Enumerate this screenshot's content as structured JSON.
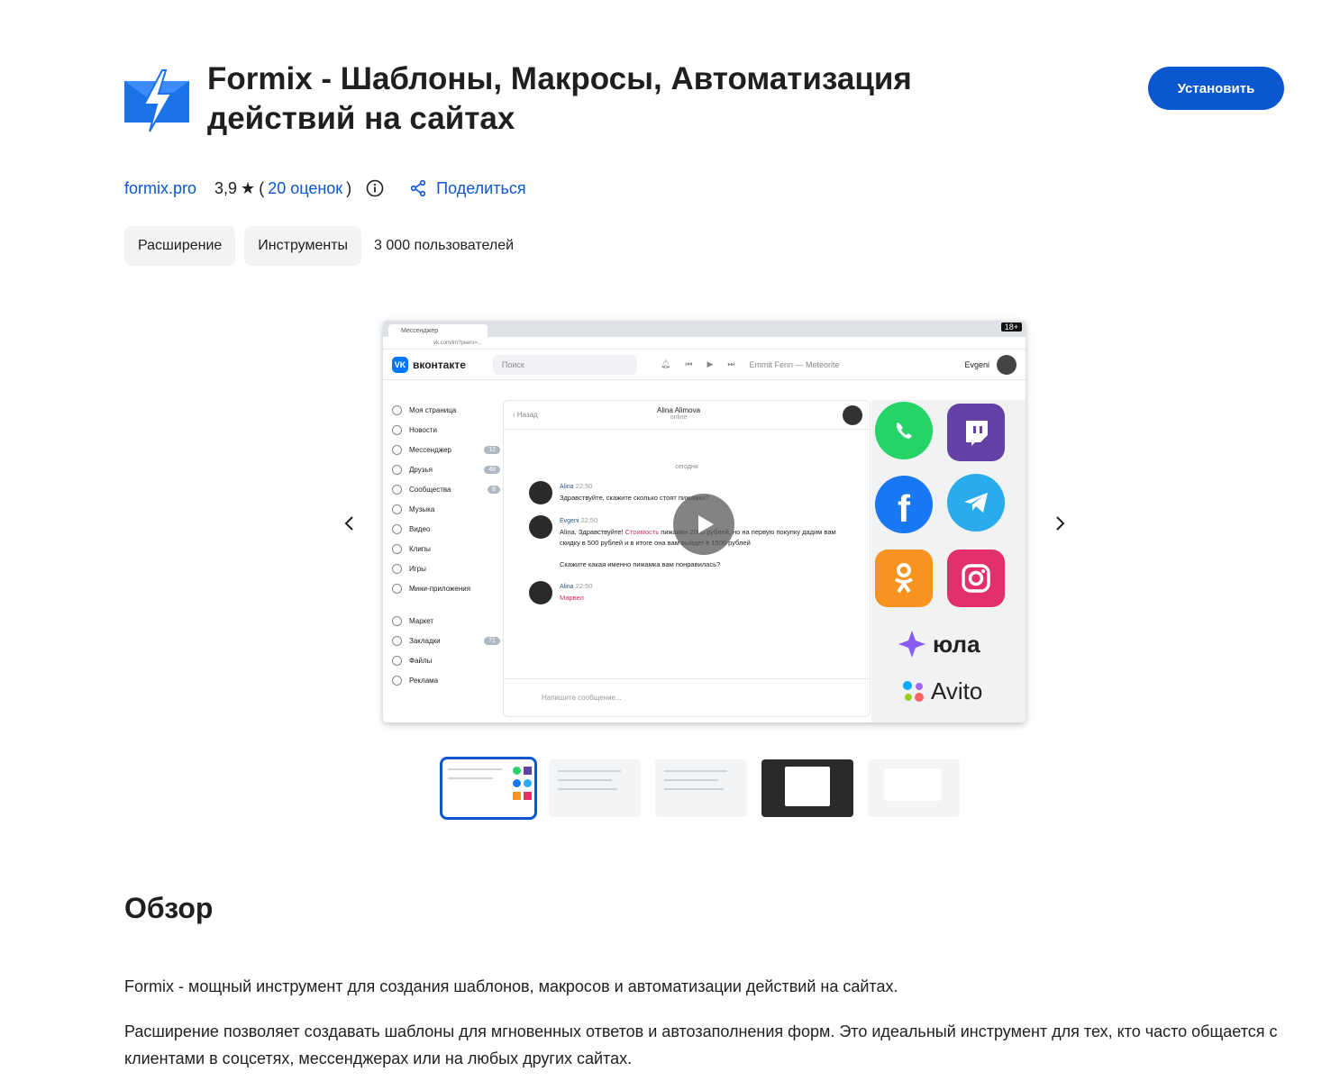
{
  "header": {
    "title_line1": "Formix - Шаблоны, Макросы, Автоматизация",
    "title_line2": "действий на сайтах",
    "install_label": "Установить",
    "logo_icon": "lightning-envelope-icon"
  },
  "meta": {
    "site": "formix.pro",
    "rating": "3,9",
    "reviews_open": "(",
    "reviews": "20 оценок",
    "reviews_close": ")",
    "share_label": "Поделиться"
  },
  "chips": {
    "type": "Расширение",
    "category": "Инструменты",
    "users": "3 000 пользователей"
  },
  "screenshot": {
    "tab_title": "Мессенджер",
    "age_badge": "18+",
    "address": "vk.com/im?peers=...",
    "brand": "вконтакте",
    "search_placeholder": "Поиск",
    "player_track": "Emmit Fenn — Meteorite",
    "user_name": "Evgeni",
    "sidebar": [
      {
        "label": "Моя страница",
        "count": ""
      },
      {
        "label": "Новости",
        "count": ""
      },
      {
        "label": "Мессенджер",
        "count": "12"
      },
      {
        "label": "Друзья",
        "count": "48"
      },
      {
        "label": "Сообщества",
        "count": "8"
      },
      {
        "label": "Музыка",
        "count": ""
      },
      {
        "label": "Видео",
        "count": ""
      },
      {
        "label": "Клипы",
        "count": ""
      },
      {
        "label": "Игры",
        "count": ""
      },
      {
        "label": "Мини-приложения",
        "count": ""
      }
    ],
    "sidebar2": [
      {
        "label": "Маркет",
        "count": ""
      },
      {
        "label": "Закладки",
        "count": "71"
      },
      {
        "label": "Файлы",
        "count": ""
      },
      {
        "label": "Реклама",
        "count": ""
      }
    ],
    "chat_back": "Назад",
    "chat_name": "Alina Alimova",
    "chat_status": "online",
    "today": "сегодня",
    "msg1_name": "Alina",
    "msg1_time": "22:50",
    "msg1_text": "Здравствуйте, скажите сколько стоят пижамки?",
    "msg2_name": "Evgeni",
    "msg2_time": "22:50",
    "msg2_pre": "Alina, Здравствуйте! ",
    "msg2_pink": "Стоимость",
    "msg2_text": " пижамки 2000 рублей, но на первую покупку дадим вам скидку в 500 рублей и в итоге она вам выйдет в 1500 рублей",
    "msg2_q": "Скажите какая именно пижамка вам понравилась?",
    "msg3_name": "Alina",
    "msg3_time": "22:50",
    "msg3_text": "Марвел",
    "input_placeholder": "Напишите сообщение...",
    "brand_yula": "юла",
    "brand_avito": "Avito"
  },
  "overview": {
    "heading": "Обзор",
    "p1": "Formix - мощный инструмент для создания шаблонов, макросов и автоматизации действий на сайтах.",
    "p2": "Расширение позволяет создавать шаблоны  для мгновенных ответов и автозаполнения форм. Это идеальный инструмент для тех, кто часто общается с клиентами в соцсетях, мессенджерах или на любых других сайтах."
  },
  "colors": {
    "accent": "#0b57d0",
    "chip_bg": "#f1f3f4",
    "whatsapp": "#25d366",
    "twitch": "#6441a5",
    "facebook": "#1877f2",
    "telegram": "#2aabee",
    "odnoklassniki": "#f7931e",
    "instagram": "#e1306c"
  }
}
